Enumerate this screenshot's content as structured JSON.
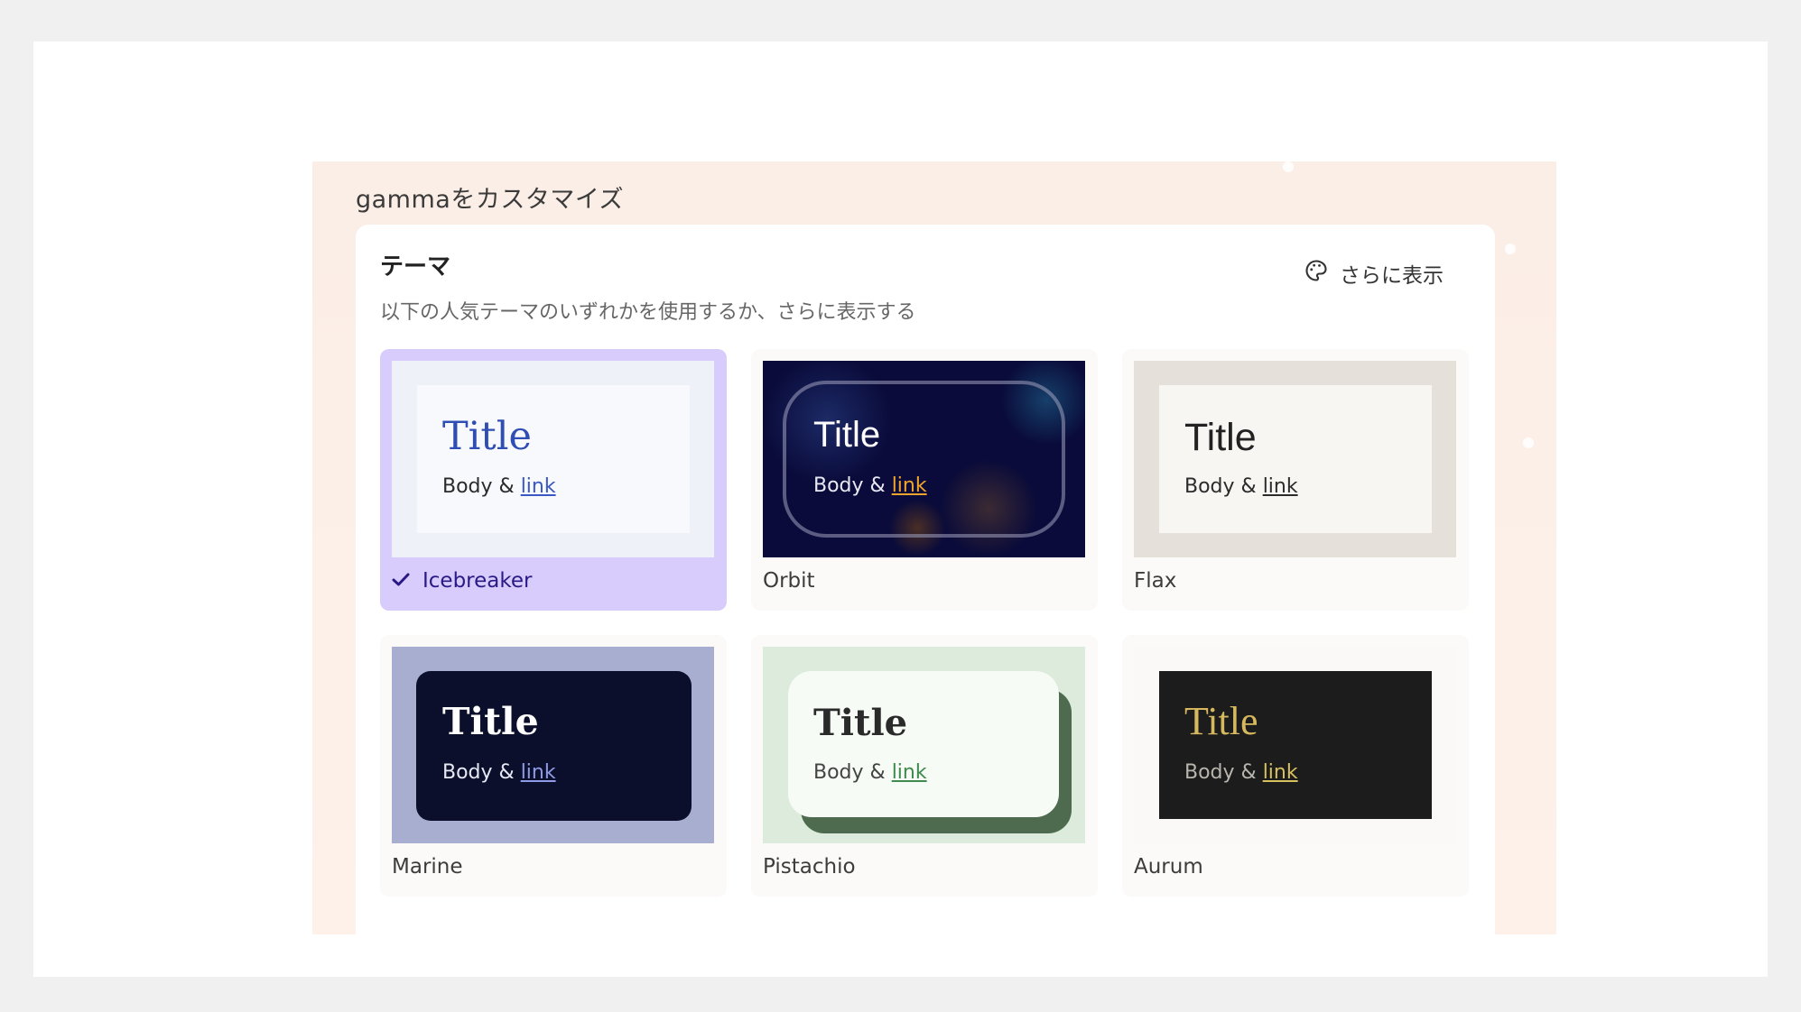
{
  "panel": {
    "title": "gammaをカスタマイズ"
  },
  "theme_section": {
    "heading": "テーマ",
    "subtitle": "以下の人気テーマのいずれかを使用するか、さらに表示する",
    "more_button": {
      "icon": "palette-icon",
      "label": "さらに表示"
    }
  },
  "preview_text": {
    "title": "Title",
    "body": "Body & ",
    "link": "link"
  },
  "themes": [
    {
      "name": "Icebreaker",
      "selected": true,
      "check_icon": "check-icon",
      "accent": "#2f4eb4"
    },
    {
      "name": "Orbit",
      "selected": false,
      "accent": "#f0a42b"
    },
    {
      "name": "Flax",
      "selected": false,
      "accent": "#2b2b2b"
    },
    {
      "name": "Marine",
      "selected": false,
      "accent": "#8f9be6"
    },
    {
      "name": "Pistachio",
      "selected": false,
      "accent": "#3f8a4f"
    },
    {
      "name": "Aurum",
      "selected": false,
      "accent": "#d6b85e"
    }
  ]
}
